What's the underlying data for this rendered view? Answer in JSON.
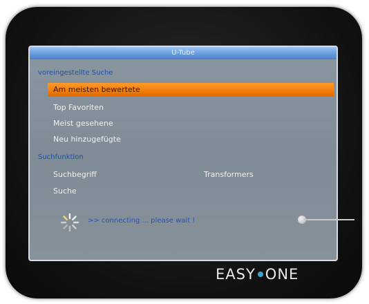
{
  "window": {
    "title": "U-Tube"
  },
  "presets": {
    "header": "voreingestellte Suche",
    "items": [
      "Am meisten bewertete",
      "Top Favoriten",
      "Meist gesehene",
      "Neu hinzugefügte"
    ],
    "selected_index": 0
  },
  "search": {
    "header": "Suchfunktion",
    "term_label": "Suchbegriff",
    "term_value": "Transformers",
    "search_button": "Suche"
  },
  "status": {
    "message": ">> connecting ... please wait !",
    "icon": "loading-spinner-icon"
  },
  "brand": {
    "part1": "EASY",
    "part2": "ONE",
    "logo_color": "#39a8c8"
  },
  "colors": {
    "accent_selected": "#f07d0a",
    "title_bar": "#6a9fe0",
    "header_text": "#1f4fa8",
    "status_text": "#2a50b8"
  }
}
